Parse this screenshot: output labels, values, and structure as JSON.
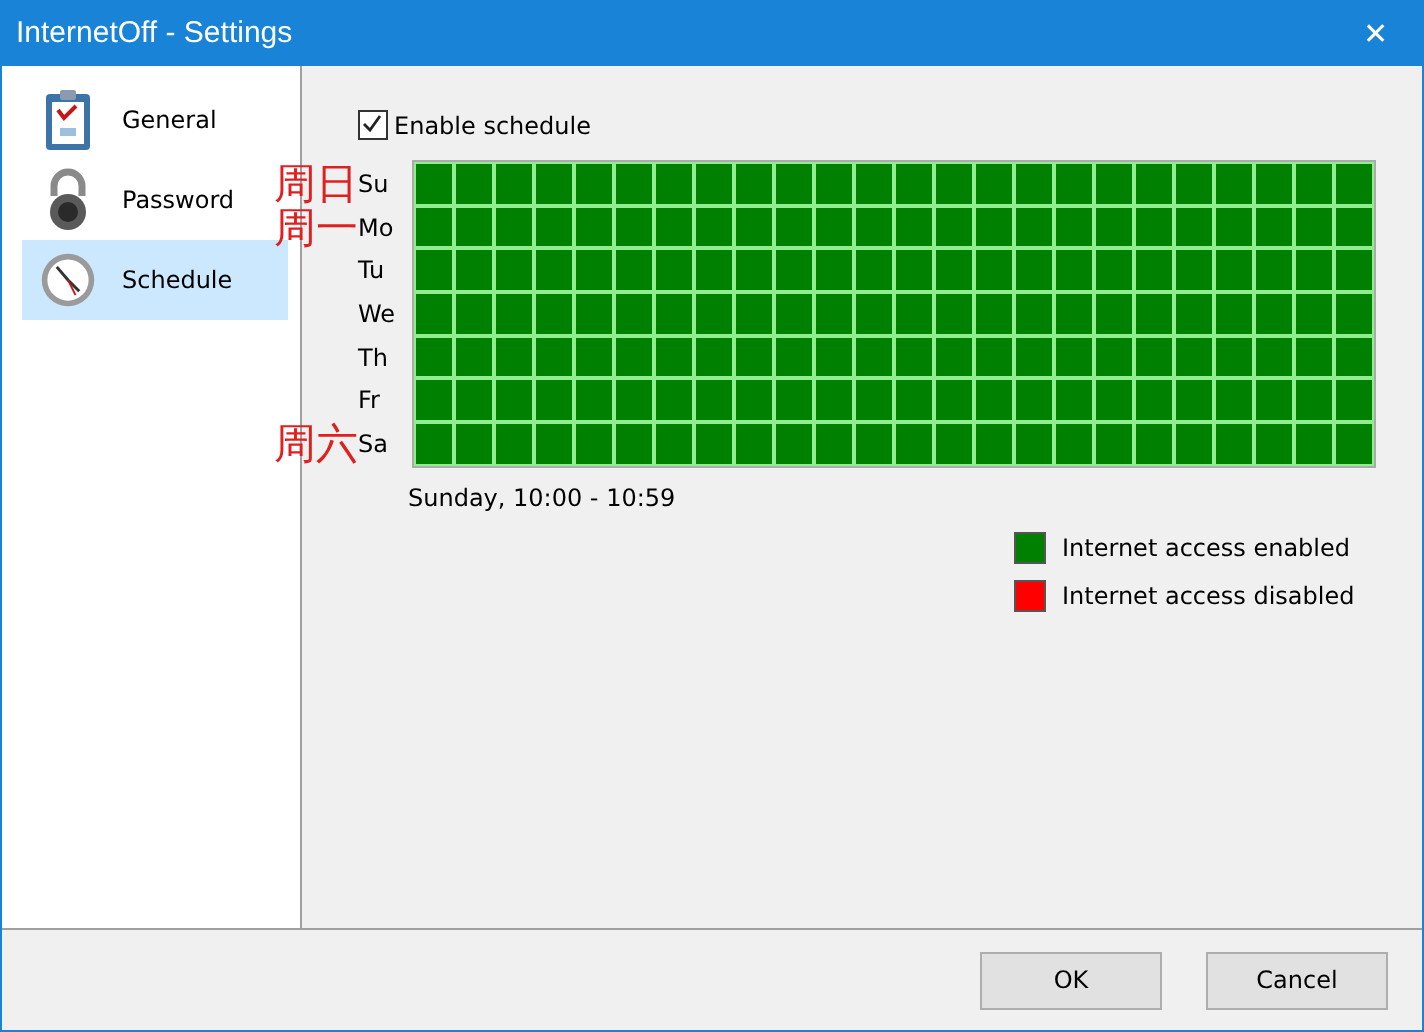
{
  "window": {
    "title": "InternetOff - Settings",
    "close": "✕"
  },
  "sidebar": {
    "items": [
      {
        "label": "General",
        "kind": "clipboard",
        "selected": false
      },
      {
        "label": "Password",
        "kind": "lock",
        "selected": false
      },
      {
        "label": "Schedule",
        "kind": "clock",
        "selected": true
      }
    ]
  },
  "schedule": {
    "enable": {
      "label": "Enable schedule",
      "checked": true
    },
    "days": [
      {
        "label": "Su",
        "annotation": "周日",
        "hours": [
          true,
          true,
          true,
          true,
          true,
          true,
          true,
          true,
          true,
          true,
          true,
          true,
          true,
          true,
          true,
          true,
          true,
          true,
          true,
          true,
          true,
          true,
          true,
          true
        ]
      },
      {
        "label": "Mo",
        "annotation": "周一",
        "hours": [
          true,
          true,
          true,
          true,
          true,
          true,
          true,
          true,
          true,
          true,
          true,
          true,
          true,
          true,
          true,
          true,
          true,
          true,
          true,
          true,
          true,
          true,
          true,
          true
        ]
      },
      {
        "label": "Tu",
        "hours": [
          true,
          true,
          true,
          true,
          true,
          true,
          true,
          true,
          true,
          true,
          true,
          true,
          true,
          true,
          true,
          true,
          true,
          true,
          true,
          true,
          true,
          true,
          true,
          true
        ]
      },
      {
        "label": "We",
        "hours": [
          true,
          true,
          true,
          true,
          true,
          true,
          true,
          true,
          true,
          true,
          true,
          true,
          true,
          true,
          true,
          true,
          true,
          true,
          true,
          true,
          true,
          true,
          true,
          true
        ]
      },
      {
        "label": "Th",
        "hours": [
          true,
          true,
          true,
          true,
          true,
          true,
          true,
          true,
          true,
          true,
          true,
          true,
          true,
          true,
          true,
          true,
          true,
          true,
          true,
          true,
          true,
          true,
          true,
          true
        ]
      },
      {
        "label": "Fr",
        "hours": [
          true,
          true,
          true,
          true,
          true,
          true,
          true,
          true,
          true,
          true,
          true,
          true,
          true,
          true,
          true,
          true,
          true,
          true,
          true,
          true,
          true,
          true,
          true,
          true
        ]
      },
      {
        "label": "Sa",
        "annotation": "周六",
        "hours": [
          true,
          true,
          true,
          true,
          true,
          true,
          true,
          true,
          true,
          true,
          true,
          true,
          true,
          true,
          true,
          true,
          true,
          true,
          true,
          true,
          true,
          true,
          true,
          true
        ]
      }
    ],
    "hover_info": "Sunday, 10:00 - 10:59",
    "legend": [
      {
        "label": "Internet access enabled",
        "color": "#008000"
      },
      {
        "label": "Internet access disabled",
        "color": "#ff0000"
      }
    ]
  },
  "buttons": [
    {
      "label": "OK"
    },
    {
      "label": "Cancel"
    }
  ]
}
